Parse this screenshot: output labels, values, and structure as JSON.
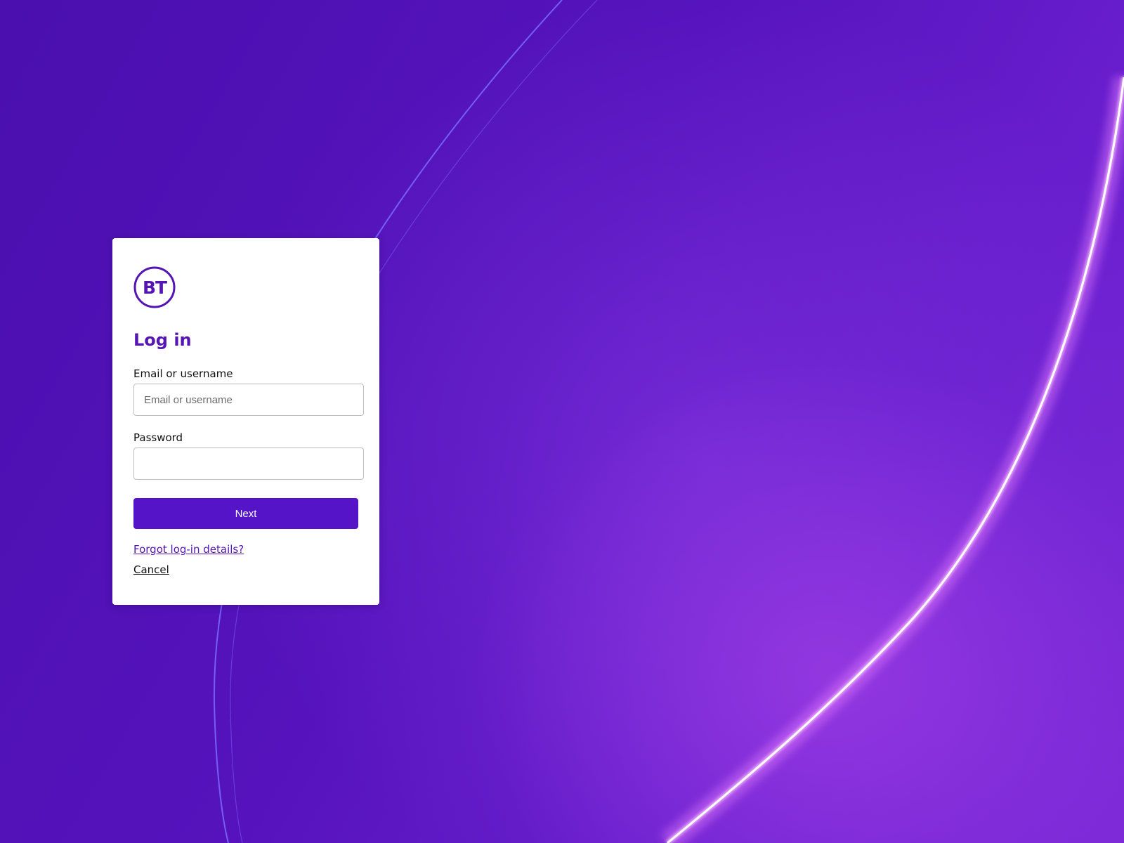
{
  "brand": {
    "logo_text": "BT",
    "primary_color": "#5514b4",
    "button_color": "#5514c8"
  },
  "login": {
    "title": "Log in",
    "email_label": "Email or username",
    "email_placeholder": "Email or username",
    "email_value": "",
    "password_label": "Password",
    "password_value": "",
    "next_label": "Next",
    "forgot_label": "Forgot log-in details?",
    "cancel_label": "Cancel"
  }
}
